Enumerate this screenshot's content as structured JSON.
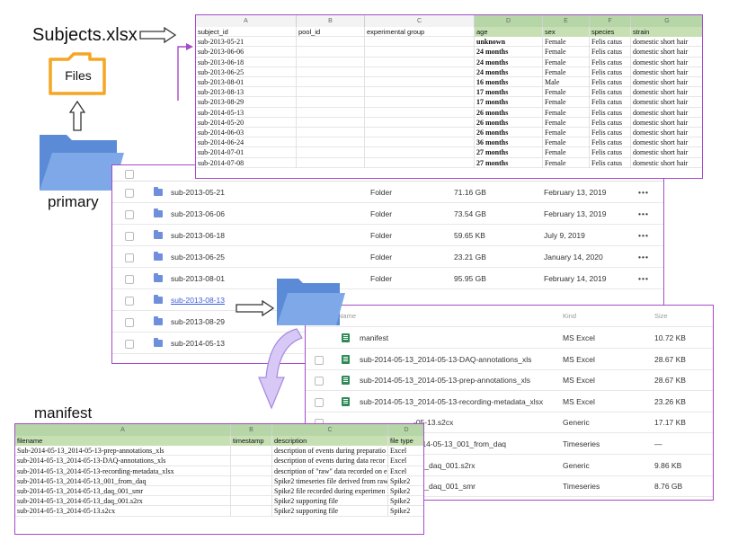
{
  "labels": {
    "subjects_file": "Subjects.xlsx",
    "files_folder": "Files",
    "primary_folder": "primary",
    "manifest_title": "manifest"
  },
  "subjects_sheet": {
    "columns": [
      "A",
      "B",
      "C",
      "D",
      "E",
      "F",
      "G"
    ],
    "headers": [
      "subject_id",
      "pool_id",
      "experimental group",
      "age",
      "sex",
      "species",
      "strain"
    ],
    "rows": [
      [
        "sub-2013-05-21",
        "",
        "",
        "unknown",
        "Female",
        "Felis catus",
        "domestic short hair"
      ],
      [
        "sub-2013-06-06",
        "",
        "",
        "24 months",
        "Female",
        "Felis catus",
        "domestic short hair"
      ],
      [
        "sub-2013-06-18",
        "",
        "",
        "24 months",
        "Female",
        "Felis catus",
        "domestic short hair"
      ],
      [
        "sub-2013-06-25",
        "",
        "",
        "24 months",
        "Female",
        "Felis catus",
        "domestic short hair"
      ],
      [
        "sub-2013-08-01",
        "",
        "",
        "16 months",
        "Male",
        "Felis catus",
        "domestic short hair"
      ],
      [
        "sub-2013-08-13",
        "",
        "",
        "17 months",
        "Female",
        "Felis catus",
        "domestic short hair"
      ],
      [
        "sub-2013-08-29",
        "",
        "",
        "17 months",
        "Female",
        "Felis catus",
        "domestic short hair"
      ],
      [
        "sub-2014-05-13",
        "",
        "",
        "26 months",
        "Female",
        "Felis catus",
        "domestic short hair"
      ],
      [
        "sub-2014-05-20",
        "",
        "",
        "26 months",
        "Female",
        "Felis catus",
        "domestic short hair"
      ],
      [
        "sub-2014-06-03",
        "",
        "",
        "26 months",
        "Female",
        "Felis catus",
        "domestic short hair"
      ],
      [
        "sub-2014-06-24",
        "",
        "",
        "36 months",
        "Female",
        "Felis catus",
        "domestic short hair"
      ],
      [
        "sub-2014-07-01",
        "",
        "",
        "27 months",
        "Female",
        "Felis catus",
        "domestic short hair"
      ],
      [
        "sub-2014-07-08",
        "",
        "",
        "27 months",
        "Female",
        "Felis catus",
        "domestic short hair"
      ]
    ]
  },
  "primary_browser": {
    "headers": [
      "Kind",
      "Size",
      "Date Created"
    ],
    "rows": [
      {
        "name": "sub-2013-05-21",
        "kind": "Folder",
        "size": "71.16 GB",
        "date": "February 13, 2019"
      },
      {
        "name": "sub-2013-06-06",
        "kind": "Folder",
        "size": "73.54 GB",
        "date": "February 13, 2019"
      },
      {
        "name": "sub-2013-06-18",
        "kind": "Folder",
        "size": "59.65 KB",
        "date": "July 9, 2019"
      },
      {
        "name": "sub-2013-06-25",
        "kind": "Folder",
        "size": "23.21 GB",
        "date": "January 14, 2020"
      },
      {
        "name": "sub-2013-08-01",
        "kind": "Folder",
        "size": "95.95 GB",
        "date": "February 14, 2019"
      },
      {
        "name": "sub-2013-08-13",
        "kind": "",
        "size": "",
        "date": ""
      },
      {
        "name": "sub-2013-08-29",
        "kind": "",
        "size": "",
        "date": ""
      },
      {
        "name": "sub-2014-05-13",
        "kind": "",
        "size": "",
        "date": ""
      }
    ],
    "more": "•••"
  },
  "subject_browser": {
    "headers": [
      "Name",
      "Kind",
      "Size"
    ],
    "rows": [
      {
        "name": "manifest",
        "kind": "MS Excel",
        "size": "10.72 KB"
      },
      {
        "name": "sub-2014-05-13_2014-05-13-DAQ-annotations_xls",
        "kind": "MS Excel",
        "size": "28.67 KB"
      },
      {
        "name": "sub-2014-05-13_2014-05-13-prep-annotations_xls",
        "kind": "MS Excel",
        "size": "28.67 KB"
      },
      {
        "name": "sub-2014-05-13_2014-05-13-recording-metadata_xlsx",
        "kind": "MS Excel",
        "size": "23.26 KB"
      },
      {
        "name": "-05-13.s2cx",
        "kind": "Generic",
        "size": "17.17 KB"
      },
      {
        "name": "2014-05-13_001_from_daq",
        "kind": "Timeseries",
        "size": "—"
      },
      {
        "name": "-13_daq_001.s2rx",
        "kind": "Generic",
        "size": "9.86 KB"
      },
      {
        "name": "-13_daq_001_smr",
        "kind": "Timeseries",
        "size": "8.76 GB"
      }
    ]
  },
  "manifest_sheet": {
    "columns": [
      "A",
      "B",
      "C",
      "D"
    ],
    "headers": [
      "filename",
      "timestamp",
      "description",
      "file type"
    ],
    "rows": [
      [
        "Sub-2014-05-13_2014-05-13-prep-annotations_xls",
        "",
        "description of events during preparatio",
        "Excel"
      ],
      [
        "sub-2014-05-13_2014-05-13-DAQ-annotations_xls",
        "",
        "description of events during data recor",
        "Excel"
      ],
      [
        "sub-2014-05-13_2014-05-13-recording-metadata_xlsx",
        "",
        "description of \"raw\" data recorded on e",
        "Excel"
      ],
      [
        "sub-2014-05-13_2014-05-13_001_from_daq",
        "",
        "Spike2 timeseries file derived from raw",
        "Spike2"
      ],
      [
        "sub-2014-05-13_2014-05-13_daq_001_smr",
        "",
        "Spike2 file recorded during experimen",
        "Spike2"
      ],
      [
        "sub-2014-05-13_2014-05-13_daq_001.s2rx",
        "",
        "Spike2 supporting file",
        "Spike2"
      ],
      [
        "sub-2014-05-13_2014-05-13.s2cx",
        "",
        "Spike2 supporting file",
        "Spike2"
      ]
    ]
  },
  "colors": {
    "accent_border": "#a64ac9",
    "folder_blue": "#6f8fdc",
    "folder_orange": "#f5a623",
    "header_green": "#c6e0b4"
  },
  "icons": [
    "folder-icon",
    "excel-file-icon",
    "arrow-right-icon",
    "arrow-up-icon",
    "curved-arrow-down-icon"
  ]
}
